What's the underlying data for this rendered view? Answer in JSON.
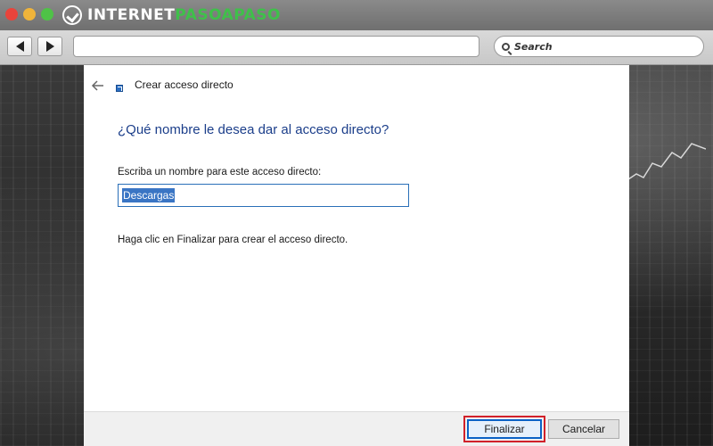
{
  "browser": {
    "brand_prefix": "INTERNET",
    "brand_accent": "PASOAPASO",
    "search_placeholder": "Search"
  },
  "wizard": {
    "title": "Crear acceso directo",
    "heading": "¿Qué nombre le desea dar al acceso directo?",
    "field_label": "Escriba un nombre para este acceso directo:",
    "field_value": "Descargas",
    "instructions": "Haga clic en Finalizar para crear el acceso directo.",
    "finish_label": "Finalizar",
    "cancel_label": "Cancelar"
  },
  "colors": {
    "heading": "#1b3e8a",
    "highlight": "#d1212a",
    "brand_accent": "#3fc04a"
  },
  "icons": [
    "close-dot",
    "minimize-dot",
    "maximize-dot",
    "brand-check-icon",
    "back-arrow-icon",
    "forward-arrow-icon",
    "search-icon",
    "shortcut-icon",
    "wizard-back-icon"
  ]
}
